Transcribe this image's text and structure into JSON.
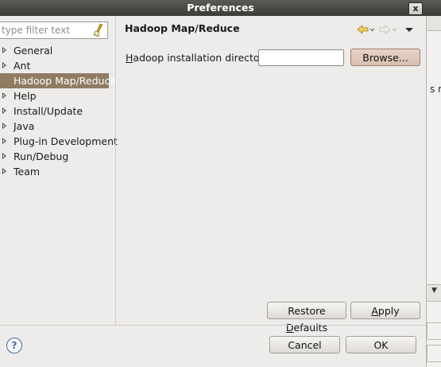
{
  "window": {
    "title": "Preferences",
    "close_label": "x"
  },
  "filter": {
    "placeholder": "type filter text"
  },
  "tree": {
    "items": [
      {
        "label": "General",
        "expandable": true
      },
      {
        "label": "Ant",
        "expandable": true
      },
      {
        "label": "Hadoop Map/Reduce",
        "expandable": false,
        "selected": true
      },
      {
        "label": "Help",
        "expandable": true
      },
      {
        "label": "Install/Update",
        "expandable": true
      },
      {
        "label": "Java",
        "expandable": true
      },
      {
        "label": "Plug-in Development",
        "expandable": true
      },
      {
        "label": "Run/Debug",
        "expandable": true
      },
      {
        "label": "Team",
        "expandable": true
      }
    ]
  },
  "page": {
    "title": "Hadoop Map/Reduce",
    "field_label_mnemonic": "H",
    "field_label_rest": "adoop installation directory:",
    "field_value": "",
    "browse_label": "Browse..."
  },
  "page_buttons": {
    "restore_pre": "Restore ",
    "restore_mnemonic": "D",
    "restore_post": "efaults",
    "apply_mnemonic": "A",
    "apply_rest": "pply"
  },
  "dialog_buttons": {
    "cancel": "Cancel",
    "ok": "OK"
  },
  "background": {
    "fragment_text": "s no"
  },
  "colors": {
    "selection": "#8e7c63",
    "titlebar": "#3c3b37",
    "help": "#3e6aa3"
  }
}
